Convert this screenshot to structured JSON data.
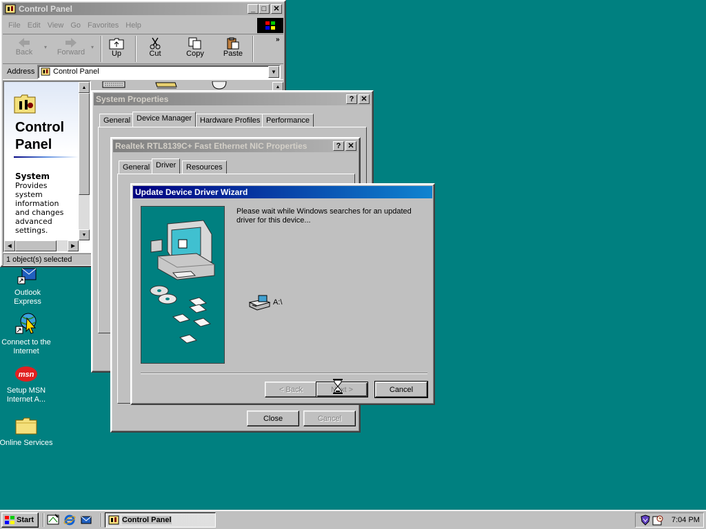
{
  "control_panel": {
    "title": "Control Panel",
    "menu": [
      "File",
      "Edit",
      "View",
      "Go",
      "Favorites",
      "Help"
    ],
    "toolbar": {
      "back": "Back",
      "forward": "Forward",
      "up": "Up",
      "cut": "Cut",
      "copy": "Copy",
      "paste": "Paste"
    },
    "address_label": "Address",
    "address_value": "Control Panel",
    "heading_line1": "Control",
    "heading_line2": "Panel",
    "item_title": "System",
    "item_description": "Provides system information and changes advanced settings.",
    "status": "1 object(s) selected"
  },
  "system_properties": {
    "title": "System Properties",
    "tabs": [
      "General",
      "Device Manager",
      "Hardware Profiles",
      "Performance"
    ],
    "selected_tab": "Device Manager"
  },
  "nic_properties": {
    "title": "Realtek RTL8139C+ Fast Ethernet NIC Properties",
    "tabs": [
      "General",
      "Driver",
      "Resources"
    ],
    "selected_tab": "Driver",
    "close": "Close",
    "cancel": "Cancel"
  },
  "wizard": {
    "title": "Update Device Driver Wizard",
    "message": "Please wait while Windows searches for an updated driver for this device...",
    "drive_label": "A:\\",
    "back": "< Back",
    "next": "Next >",
    "cancel": "Cancel"
  },
  "desktop_icons": [
    {
      "label": "Outlook Express"
    },
    {
      "label": "Connect to the Internet"
    },
    {
      "label": "Setup MSN Internet A..."
    },
    {
      "label": "Online Services"
    }
  ],
  "taskbar": {
    "start": "Start",
    "task": "Control Panel",
    "clock": "7:04 PM"
  },
  "colors": {
    "desktop": "#008080",
    "title_active": "#000080",
    "face": "#c0c0c0"
  }
}
